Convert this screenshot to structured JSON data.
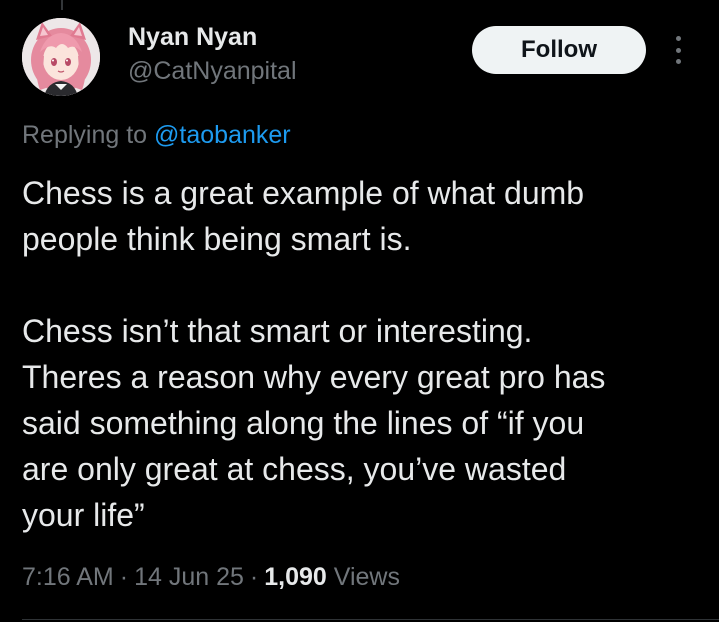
{
  "tweet": {
    "author": {
      "display_name": "Nyan Nyan",
      "handle": "@CatNyanpital",
      "avatar_icon": "anime-avatar-pink-hair"
    },
    "follow_label": "Follow",
    "more_icon": "more-vertical-icon",
    "replying_prefix": "Replying to ",
    "replying_to": "@taobanker",
    "paragraphs": [
      "Chess is a great example of what dumb\npeople think being smart is.",
      "Chess isn’t that smart or interesting.\nTheres a reason why every great pro has\nsaid something along the lines of “if you\nare only great at chess, you’ve wasted\nyour life”"
    ],
    "time": "7:16 AM",
    "date": "14 Jun 25",
    "separator": "·",
    "views_count": "1,090",
    "views_label": "Views"
  },
  "colors": {
    "background": "#000000",
    "primary_text": "#e7e9ea",
    "secondary_text": "#71767b",
    "link": "#1d9bf0",
    "follow_button_bg": "#eff3f4",
    "follow_button_text": "#0f1419"
  }
}
